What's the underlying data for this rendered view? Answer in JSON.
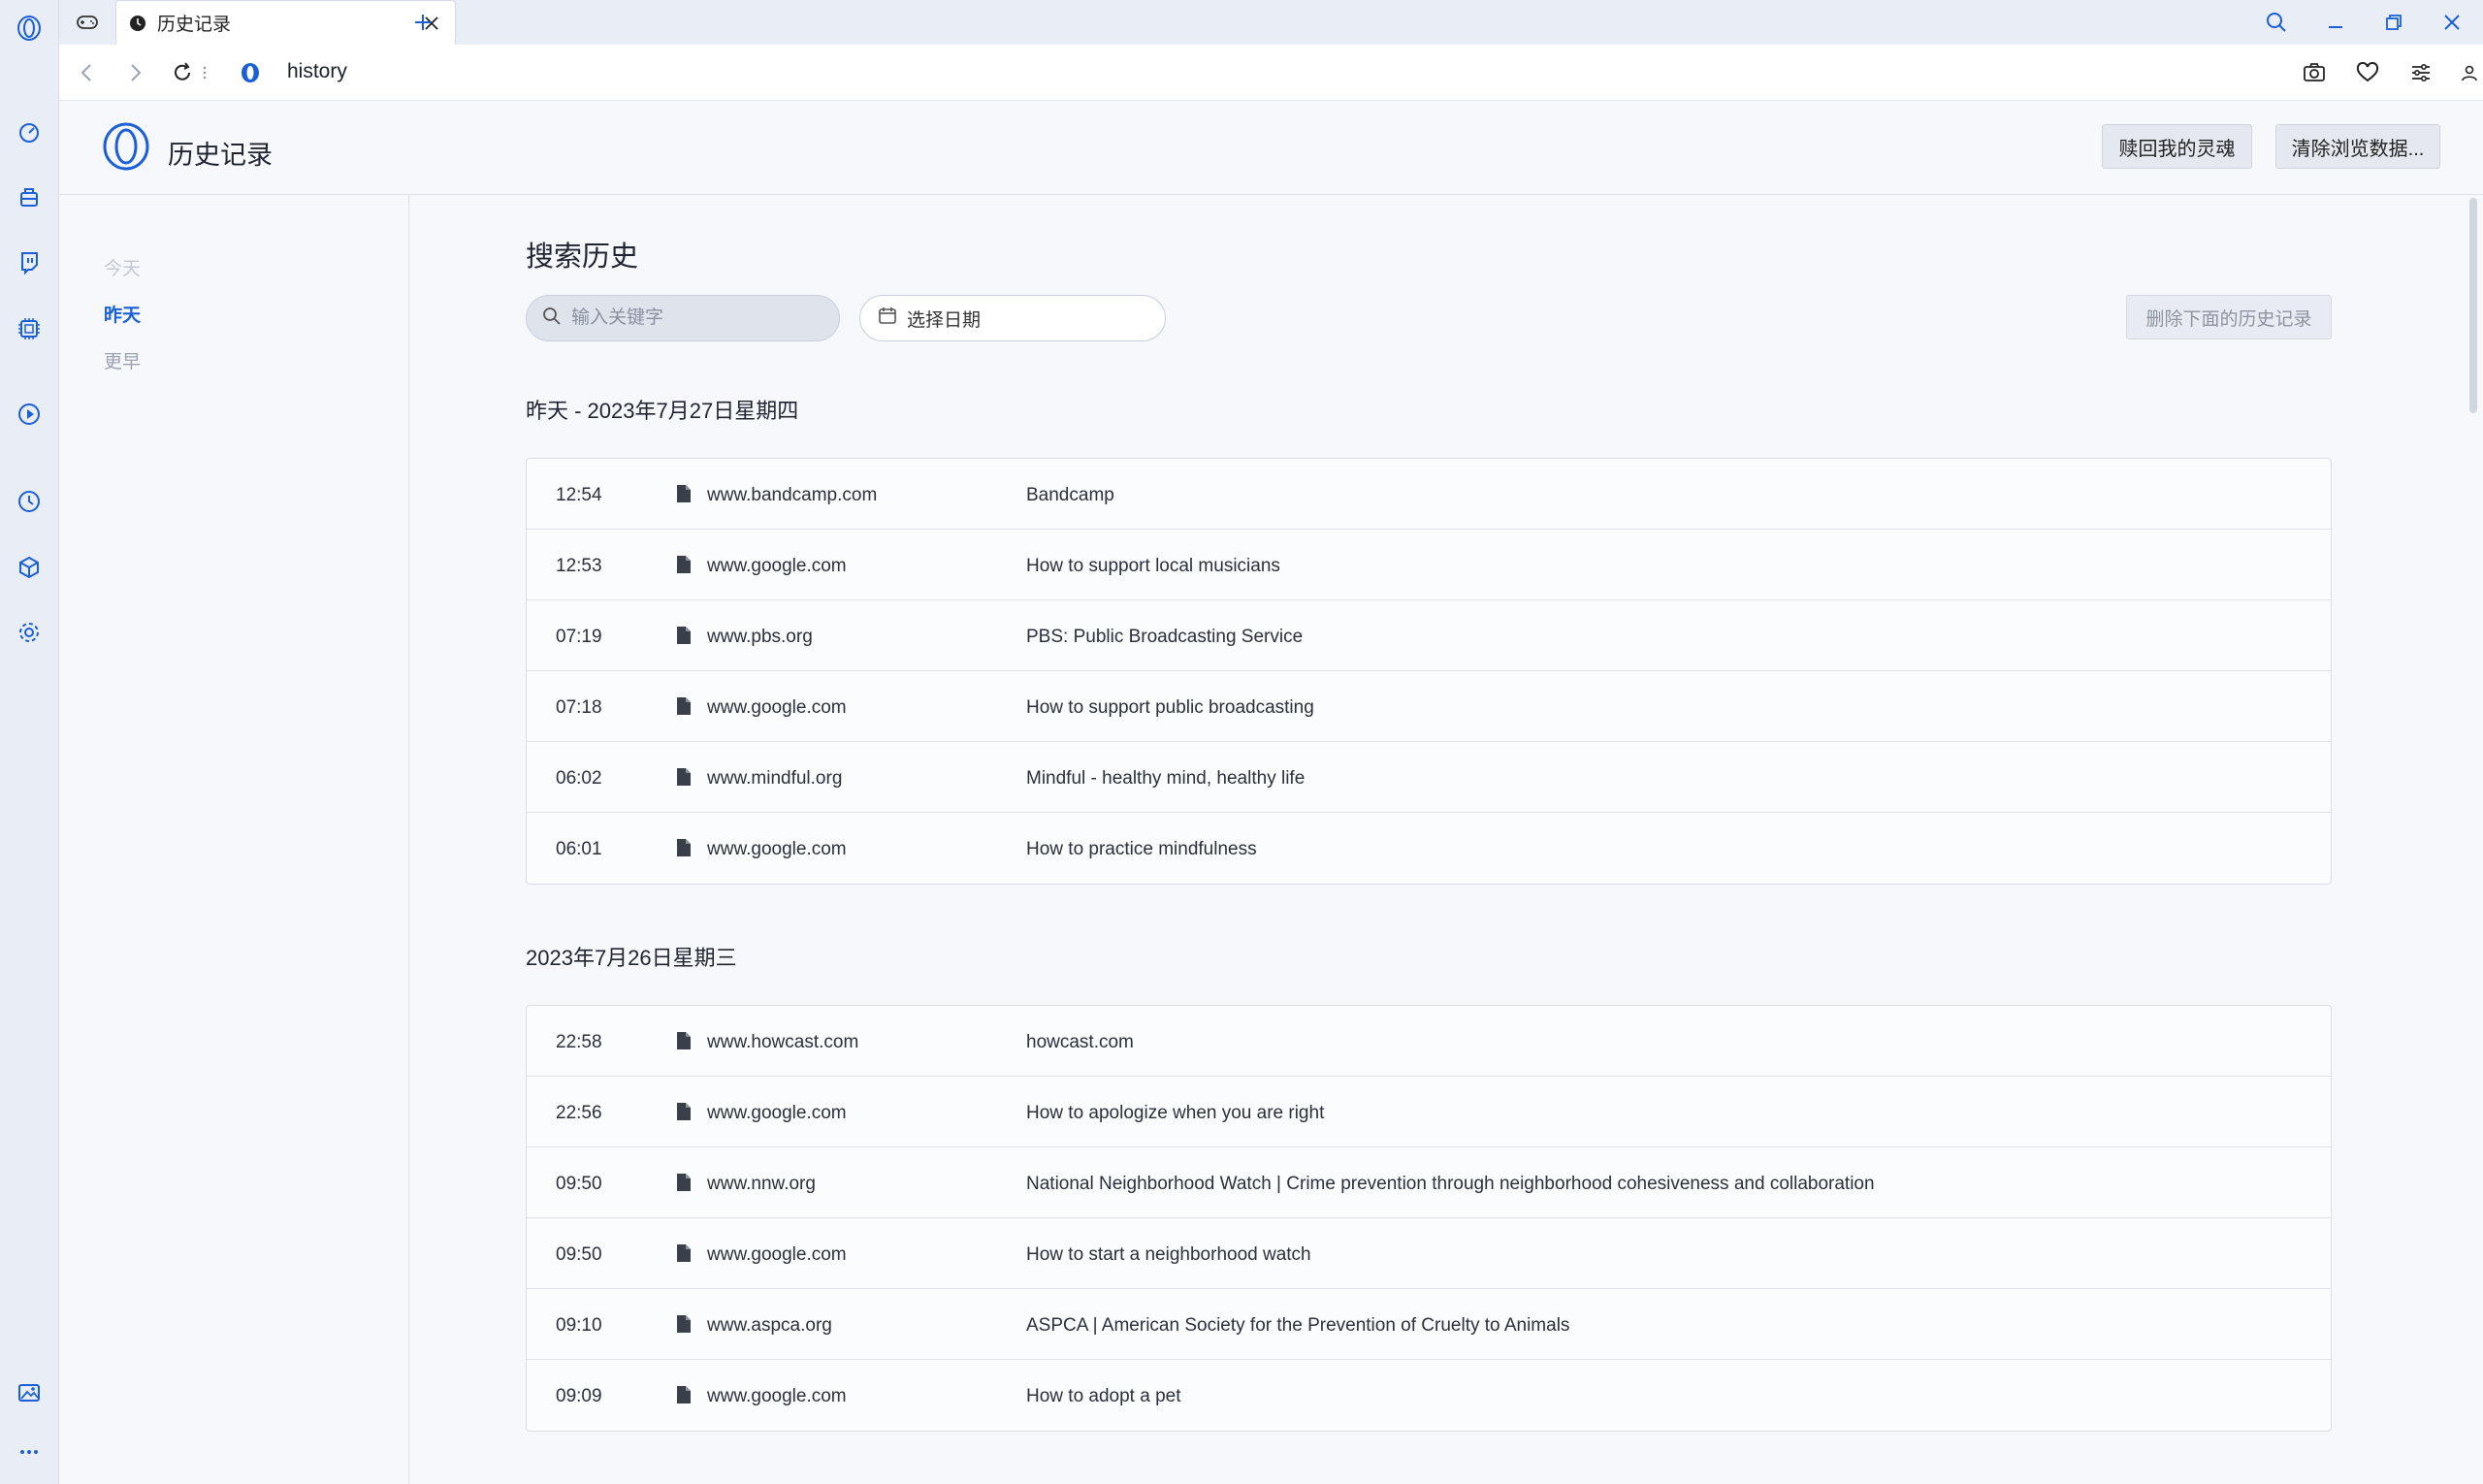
{
  "colors": {
    "accent": "#1b5fd6",
    "sidebar_bg": "#e9edf6",
    "page_bg": "#f7f8fc"
  },
  "browser": {
    "tab": {
      "title": "历史记录",
      "favicon": "clock-icon"
    },
    "address": {
      "url": "history"
    }
  },
  "sidebar": {
    "icons": [
      "opera-logo-icon",
      "speed-dial-icon",
      "briefcase-icon",
      "twitch-icon",
      "chip-icon",
      "player-icon",
      "history-icon",
      "box-icon",
      "settings-icon",
      "gallery-icon",
      "more-icon"
    ]
  },
  "header": {
    "title": "历史记录",
    "redeem_button": "赎回我的灵魂",
    "clear_button": "清除浏览数据..."
  },
  "nav": {
    "items": [
      {
        "label": "今天",
        "state": "disabled"
      },
      {
        "label": "昨天",
        "state": "active"
      },
      {
        "label": "更早",
        "state": "normal"
      }
    ]
  },
  "main": {
    "title": "搜索历史",
    "search_placeholder": "输入关键字",
    "date_label": "选择日期",
    "delete_below": "删除下面的历史记录"
  },
  "groups": [
    {
      "heading": "昨天 - 2023年7月27日星期四",
      "rows": [
        {
          "time": "12:54",
          "domain": "www.bandcamp.com",
          "title": "Bandcamp"
        },
        {
          "time": "12:53",
          "domain": "www.google.com",
          "title": "How to support local musicians"
        },
        {
          "time": "07:19",
          "domain": "www.pbs.org",
          "title": "PBS: Public Broadcasting Service"
        },
        {
          "time": "07:18",
          "domain": "www.google.com",
          "title": "How to support public broadcasting"
        },
        {
          "time": "06:02",
          "domain": "www.mindful.org",
          "title": "Mindful - healthy mind, healthy life"
        },
        {
          "time": "06:01",
          "domain": "www.google.com",
          "title": "How to practice mindfulness"
        }
      ]
    },
    {
      "heading": "2023年7月26日星期三",
      "rows": [
        {
          "time": "22:58",
          "domain": "www.howcast.com",
          "title": "howcast.com"
        },
        {
          "time": "22:56",
          "domain": "www.google.com",
          "title": "How to apologize when you are right"
        },
        {
          "time": "09:50",
          "domain": "www.nnw.org",
          "title": "National Neighborhood Watch | Crime prevention through neighborhood cohesiveness and collaboration"
        },
        {
          "time": "09:50",
          "domain": "www.google.com",
          "title": "How to start a neighborhood watch"
        },
        {
          "time": "09:10",
          "domain": "www.aspca.org",
          "title": "ASPCA | American Society for the Prevention of Cruelty to Animals"
        },
        {
          "time": "09:09",
          "domain": "www.google.com",
          "title": "How to adopt a pet"
        }
      ]
    }
  ]
}
